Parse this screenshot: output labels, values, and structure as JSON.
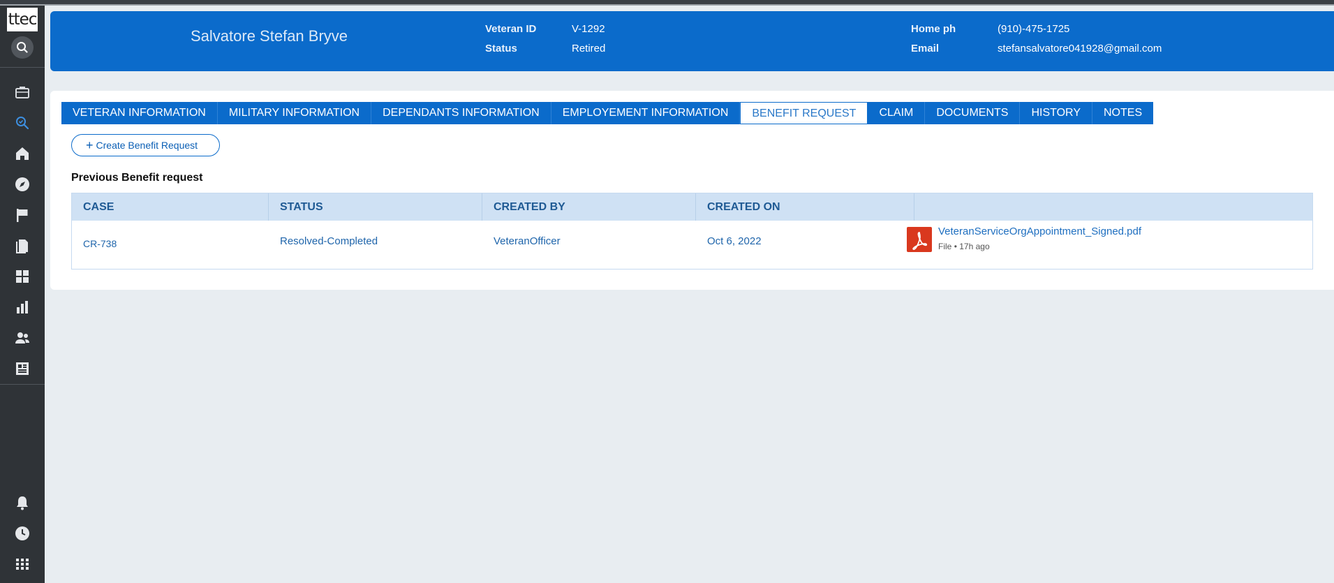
{
  "app": {
    "logo_text": "ttec"
  },
  "sidebar": {
    "icons": [
      "search-icon",
      "briefcase-icon",
      "search-check-icon",
      "home-icon",
      "compass-icon",
      "flag-icon",
      "documents-icon",
      "dashboard-icon",
      "bar-chart-icon",
      "users-icon",
      "news-icon",
      "bell-icon",
      "clock-icon",
      "apps-grid-icon"
    ]
  },
  "header": {
    "name": "Salvatore Stefan Bryve",
    "veteran_id_label": "Veteran ID",
    "veteran_id": "V-1292",
    "status_label": "Status",
    "status": "Retired",
    "home_ph_label": "Home ph",
    "home_ph": "(910)-475-1725",
    "email_label": "Email",
    "email": "stefansalvatore041928@gmail.com"
  },
  "tabs": [
    {
      "label": "VETERAN INFORMATION"
    },
    {
      "label": "MILITARY INFORMATION"
    },
    {
      "label": "DEPENDANTS INFORMATION"
    },
    {
      "label": "EMPLOYEMENT INFORMATION"
    },
    {
      "label": "BENEFIT REQUEST",
      "active": true
    },
    {
      "label": "CLAIM"
    },
    {
      "label": "DOCUMENTS"
    },
    {
      "label": "HISTORY"
    },
    {
      "label": "NOTES"
    }
  ],
  "actions": {
    "create_label": "Create Benefit Request"
  },
  "section": {
    "title": "Previous Benefit request"
  },
  "table": {
    "columns": [
      "CASE",
      "STATUS",
      "CREATED BY",
      "CREATED ON",
      ""
    ],
    "rows": [
      {
        "case": "CR-738",
        "status": "Resolved-Completed",
        "created_by": "VeteranOfficer",
        "created_on": "Oct 6, 2022",
        "file_name": "VeteranServiceOrgAppointment_Signed.pdf",
        "file_type": "File",
        "file_age": "17h ago"
      }
    ]
  },
  "colors": {
    "brand_blue": "#0b6bcb",
    "sidebar": "#2f3337",
    "background": "#e8edf1",
    "pdf_red": "#d9381e"
  }
}
